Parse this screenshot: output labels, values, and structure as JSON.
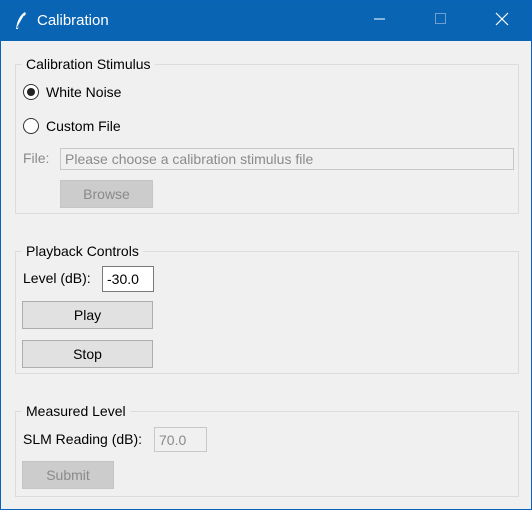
{
  "window": {
    "title": "Calibration",
    "icon": "feather-icon",
    "controls": {
      "minimize": "minimize-icon",
      "maximize": "maximize-icon",
      "close": "close-icon"
    }
  },
  "stimulus": {
    "legend": "Calibration Stimulus",
    "options": [
      {
        "label": "White Noise",
        "selected": true
      },
      {
        "label": "Custom File",
        "selected": false
      }
    ],
    "file_label": "File:",
    "file_placeholder": "Please choose a calibration stimulus file",
    "browse_label": "Browse"
  },
  "playback": {
    "legend": "Playback Controls",
    "level_label": "Level (dB):",
    "level_value": "-30.0",
    "play_label": "Play",
    "stop_label": "Stop"
  },
  "measured": {
    "legend": "Measured Level",
    "slm_label": "SLM Reading (dB):",
    "slm_value": "70.0",
    "submit_label": "Submit"
  }
}
